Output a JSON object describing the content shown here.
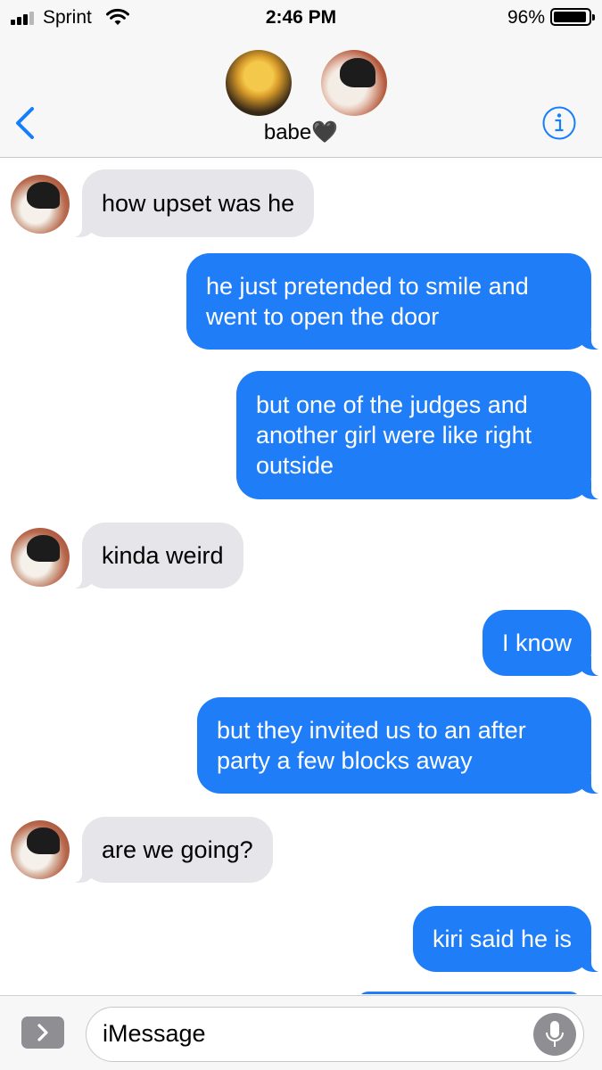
{
  "status_bar": {
    "carrier": "Sprint",
    "time": "2:46 PM",
    "battery_percent": "96%",
    "battery_level": 0.96,
    "signal_bars": 3,
    "signal_bars_total": 4,
    "icons": [
      "signal-icon",
      "wifi-icon",
      "battery-icon"
    ]
  },
  "header": {
    "contact_name": "babe🖤",
    "back_icon": "chevron-left-icon",
    "info_icon": "info-icon"
  },
  "messages": [
    {
      "direction": "in",
      "text": "how upset was he"
    },
    {
      "direction": "out",
      "text": "he just pretended to smile and went to open the door"
    },
    {
      "direction": "out",
      "text": "but one of the judges and another girl were like right outside"
    },
    {
      "direction": "in",
      "text": "kinda weird"
    },
    {
      "direction": "out",
      "text": "I know"
    },
    {
      "direction": "out",
      "text": "but they invited us to an after party a few blocks away"
    },
    {
      "direction": "in",
      "text": "are we going?"
    },
    {
      "direction": "out",
      "text": "kiri said he is"
    }
  ],
  "input": {
    "placeholder": "iMessage",
    "apps_icon": "chevron-right-icon",
    "mic_icon": "microphone-icon"
  },
  "colors": {
    "outgoing_bubble": "#1f7ef7",
    "incoming_bubble": "#e5e5ea",
    "accent": "#147efb",
    "bar_background": "#f7f7f7"
  }
}
